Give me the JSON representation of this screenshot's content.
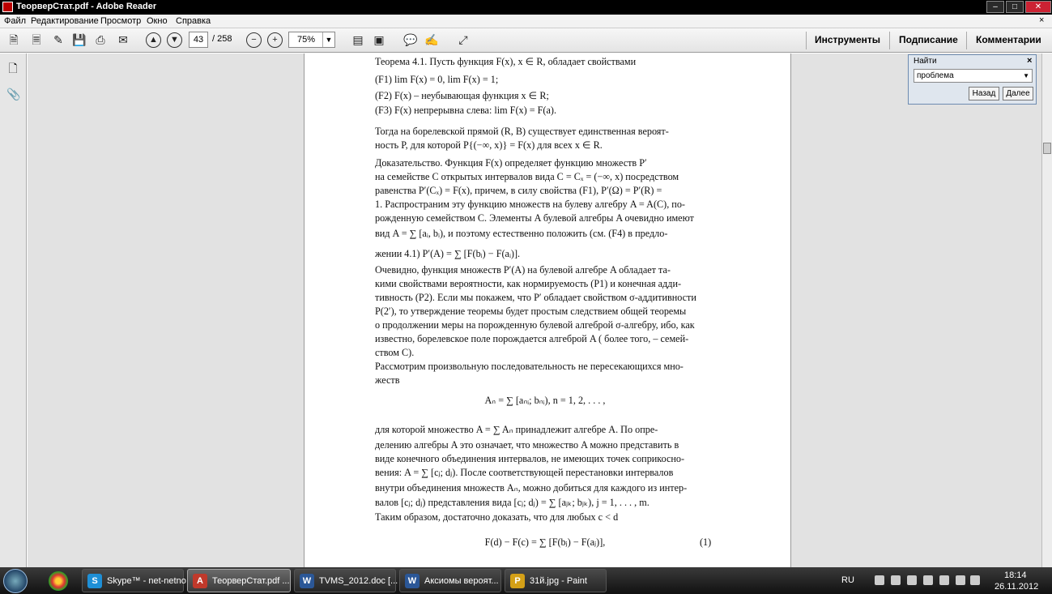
{
  "window": {
    "title": "ТеорверСтат.pdf - Adobe Reader",
    "buttons": {
      "minimize": "–",
      "maximize": "□",
      "close": "✕"
    }
  },
  "menu": {
    "items": [
      "Файл",
      "Редактирование",
      "Просмотр",
      "Окно",
      "Справка"
    ],
    "close": "×"
  },
  "toolbar": {
    "page_current": "43",
    "page_total": "/ 258",
    "zoom": "75%",
    "right_buttons": [
      "Инструменты",
      "Подписание",
      "Комментарии"
    ]
  },
  "find": {
    "title": "Найти",
    "query": "проблема",
    "back": "Назад",
    "next": "Далее"
  },
  "document": {
    "lines": [
      "Теорема 4.1. Пусть функция F(x), x ∈ R, обладает свойствами",
      "(F1)   lim F(x) = 0,   lim F(x) = 1;",
      "(F2)   F(x) – неубывающая функция x ∈ R;",
      "(F3)   F(x) непрерывна слева: lim F(x) = F(a).",
      "Тогда на борелевской прямой (R, B) существует единственная вероят-",
      "ность P, для которой P{(−∞, x)} = F(x) для всех x ∈ R.",
      "Доказательство. Функция F(x) определяет функцию множеств P′",
      "на семействе C открытых интервалов вида C = Cₓ = (−∞, x) посредством",
      "равенства P′(Cₓ) = F(x), причем, в силу свойства (F1), P′(Ω) = P′(R) =",
      "1. Распространим эту функцию множеств на булеву алгебру A = A(C), по-",
      "рожденную семейством C. Элементы A булевой алгебры A очевидно имеют",
      "вид A = ∑ [aᵢ, bᵢ), и поэтому естественно положить (см. (F4) в предло-",
      "жении 4.1) P′(A) = ∑ [F(bᵢ) − F(aᵢ)].",
      "Очевидно, функция множеств P′(A) на булевой алгебре A обладает та-",
      "кими свойствами вероятности, как нормируемость (P1) и конечная адди-",
      "тивность (P2). Если мы покажем, что P′ обладает свойством σ-аддитивности",
      "P(2′), то утверждение теоремы будет простым следствием общей теоремы",
      "о продолжении меры на порожденную булевой алгеброй σ-алгебру, ибо, как",
      "известно, борелевское поле порождается алгеброй A ( более того, – семей-",
      "ством C).",
      "Рассмотрим произвольную последовательность не пересекающихся мно-",
      "жеств",
      "Aₙ = ∑ [aₙᵢ; bₙᵢ),  n = 1, 2, . . . ,",
      "для которой множество A = ∑ Aₙ принадлежит алгебре A. По опре-",
      "делению алгебры A это означает, что множество A можно представить в",
      "виде конечного объединения интервалов, не имеющих точек соприкосно-",
      "вения: A = ∑ [cⱼ; dⱼ). После соответствующей перестановки интервалов",
      "внутри объединения множеств Aₙ, можно добиться для каждого из интер-",
      "валов [cⱼ; dⱼ) представления вида [cⱼ; dⱼ) = ∑ [aⱼₖ; bⱼₖ),  j = 1, . . . , m.",
      "Таким образом, достаточно доказать, что для любых c < d",
      "F(d) − F(c) = ∑ [F(bⱼ) − F(aⱼ)],",
      "(1)"
    ]
  },
  "taskbar": {
    "tasks": [
      {
        "label": "Skype™ - net-netno",
        "icon": "skype-icon",
        "color": "#1e8fd6",
        "glyph": "S"
      },
      {
        "label": "ТеорверСтат.pdf ...",
        "icon": "pdf-icon",
        "color": "#c0392b",
        "glyph": "A"
      },
      {
        "label": "TVMS_2012.doc [...",
        "icon": "word-icon",
        "color": "#2b5797",
        "glyph": "W"
      },
      {
        "label": "Аксиомы вероят...",
        "icon": "word-icon",
        "color": "#2b5797",
        "glyph": "W"
      },
      {
        "label": "31й.jpg - Paint",
        "icon": "paint-icon",
        "color": "#d4a017",
        "glyph": "P"
      }
    ],
    "language": "RU",
    "time": "18:14",
    "date": "26.11.2012"
  }
}
